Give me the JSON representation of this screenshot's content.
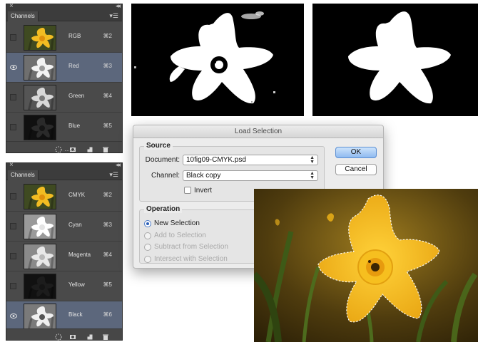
{
  "panel1": {
    "title": "Channels",
    "rows": [
      {
        "name": "RGB",
        "key": "⌘2",
        "visible": false,
        "selected": false,
        "thumb": "color"
      },
      {
        "name": "Red",
        "key": "⌘3",
        "visible": true,
        "selected": true,
        "thumb": "red"
      },
      {
        "name": "Green",
        "key": "⌘4",
        "visible": false,
        "selected": false,
        "thumb": "green"
      },
      {
        "name": "Blue",
        "key": "⌘5",
        "visible": false,
        "selected": false,
        "thumb": "blue"
      }
    ]
  },
  "panel2": {
    "title": "Channels",
    "rows": [
      {
        "name": "CMYK",
        "key": "⌘2",
        "visible": false,
        "selected": false,
        "thumb": "color"
      },
      {
        "name": "Cyan",
        "key": "⌘3",
        "visible": false,
        "selected": false,
        "thumb": "cyan"
      },
      {
        "name": "Magenta",
        "key": "⌘4",
        "visible": false,
        "selected": false,
        "thumb": "magenta"
      },
      {
        "name": "Yellow",
        "key": "⌘5",
        "visible": false,
        "selected": false,
        "thumb": "yellow"
      },
      {
        "name": "Black",
        "key": "⌘6",
        "visible": true,
        "selected": true,
        "thumb": "black"
      }
    ]
  },
  "dialog": {
    "title": "Load Selection",
    "source_label": "Source",
    "document_label": "Document:",
    "document_value": "10fig09-CMYK.psd",
    "channel_label": "Channel:",
    "channel_value": "Black copy",
    "invert_label": "Invert",
    "operation_label": "Operation",
    "operations": [
      {
        "label": "New Selection",
        "selected": true,
        "enabled": true
      },
      {
        "label": "Add to Selection",
        "selected": false,
        "enabled": false
      },
      {
        "label": "Subtract from Selection",
        "selected": false,
        "enabled": false
      },
      {
        "label": "Intersect with Selection",
        "selected": false,
        "enabled": false
      }
    ],
    "ok_label": "OK",
    "cancel_label": "Cancel"
  },
  "colors": {
    "panel_bg": "#4a4a4a",
    "selected_row": "#5c677c",
    "ok_button": "#8fbaf0",
    "flower_yellow": "#f2b71c"
  }
}
